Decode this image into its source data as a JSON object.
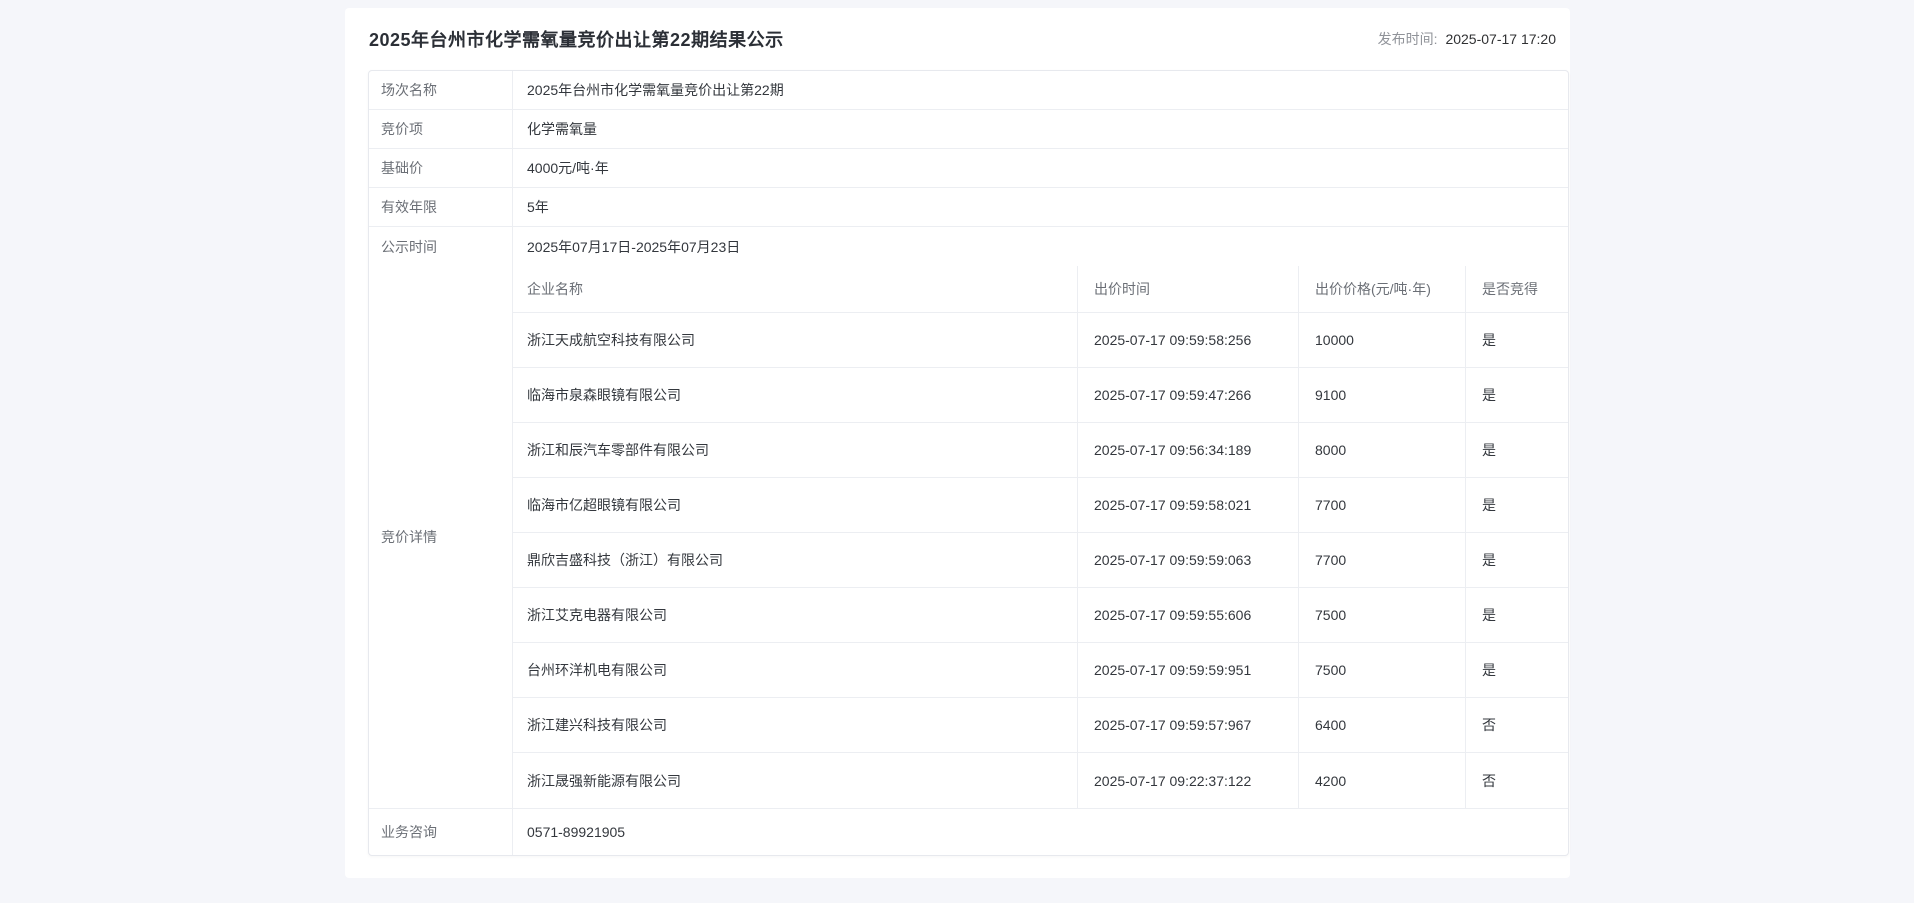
{
  "page": {
    "title": "2025年台州市化学需氧量竞价出让第22期结果公示",
    "publish_time_label": "发布时间:",
    "publish_time": "2025-07-17 17:20"
  },
  "info": {
    "rows": [
      {
        "label": "场次名称",
        "value": "2025年台州市化学需氧量竞价出让第22期"
      },
      {
        "label": "竞价项",
        "value": "化学需氧量"
      },
      {
        "label": "基础价",
        "value": "4000元/吨·年"
      },
      {
        "label": "有效年限",
        "value": "5年"
      },
      {
        "label": "公示时间",
        "value": "2025年07月17日-2025年07月23日"
      }
    ],
    "details_label": "竞价详情",
    "contact_label": "业务咨询",
    "contact_value": "0571-89921905"
  },
  "bid_table": {
    "headers": [
      "企业名称",
      "出价时间",
      "出价价格(元/吨·年)",
      "是否竞得"
    ],
    "rows": [
      [
        "浙江天成航空科技有限公司",
        "2025-07-17 09:59:58:256",
        "10000",
        "是"
      ],
      [
        "临海市泉森眼镜有限公司",
        "2025-07-17 09:59:47:266",
        "9100",
        "是"
      ],
      [
        "浙江和辰汽车零部件有限公司",
        "2025-07-17 09:56:34:189",
        "8000",
        "是"
      ],
      [
        "临海市亿超眼镜有限公司",
        "2025-07-17 09:59:58:021",
        "7700",
        "是"
      ],
      [
        "鼎欣吉盛科技（浙江）有限公司",
        "2025-07-17 09:59:59:063",
        "7700",
        "是"
      ],
      [
        "浙江艾克电器有限公司",
        "2025-07-17 09:59:55:606",
        "7500",
        "是"
      ],
      [
        "台州环洋机电有限公司",
        "2025-07-17 09:59:59:951",
        "7500",
        "是"
      ],
      [
        "浙江建兴科技有限公司",
        "2025-07-17 09:59:57:967",
        "6400",
        "否"
      ],
      [
        "浙江晟强新能源有限公司",
        "2025-07-17 09:22:37:122",
        "4200",
        "否"
      ]
    ]
  },
  "colors": {
    "page_background": "#f5f6fa",
    "card_background": "#ffffff",
    "table_border": "#eceef2",
    "label_text": "#6b6f76",
    "value_text": "#33373d",
    "muted_text": "#909399"
  }
}
